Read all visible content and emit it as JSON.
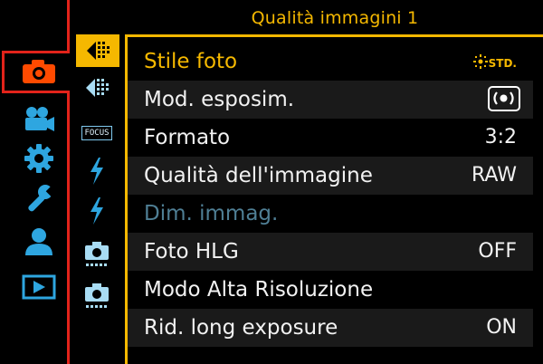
{
  "header": {
    "title": "Qualità immagini 1"
  },
  "main_menu": {
    "items": [
      {
        "name": "camera",
        "selected": true
      },
      {
        "name": "video-camera"
      },
      {
        "name": "gear"
      },
      {
        "name": "wrench"
      },
      {
        "name": "person"
      },
      {
        "name": "playback"
      }
    ]
  },
  "sub_tabs": {
    "focus_label": "FOCUS",
    "items": [
      "photo-quality-1",
      "photo-quality-2",
      "focus",
      "flash-1",
      "flash-2",
      "custom-camera-1",
      "custom-camera-2"
    ]
  },
  "menu_rows": [
    {
      "label": "Stile foto",
      "value": "STD.",
      "selected": true
    },
    {
      "label": "Mod. esposim.",
      "value": ""
    },
    {
      "label": "Formato",
      "value": "3:2"
    },
    {
      "label": "Qualità dell'immagine",
      "value": "RAW"
    },
    {
      "label": "Dim. immag.",
      "value": "",
      "disabled": true
    },
    {
      "label": "Foto HLG",
      "value": "OFF"
    },
    {
      "label": "Modo Alta Risoluzione",
      "value": ""
    },
    {
      "label": "Rid. long exposure",
      "value": "ON"
    }
  ],
  "colors": {
    "accent": "#f5b800",
    "tab_highlight": "#e2231a",
    "main_icon": "#2ea6e0",
    "disabled_text": "#4f7f95"
  }
}
